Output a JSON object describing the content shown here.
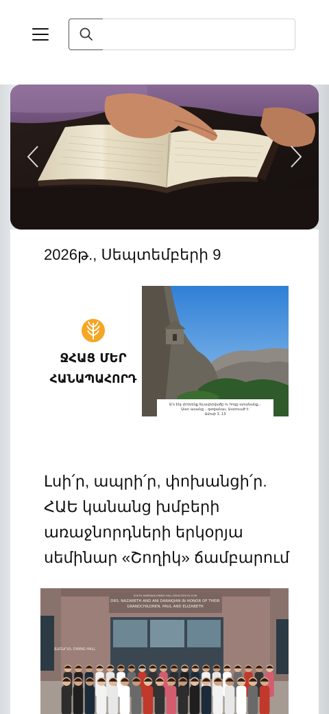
{
  "header": {
    "menu_icon": "hamburger-menu-icon",
    "search_icon": "search-icon",
    "search_placeholder": "",
    "search_value": ""
  },
  "carousel": {
    "prev_icon": "chevron-left-icon",
    "next_icon": "chevron-right-icon"
  },
  "post1": {
    "date": "2026թ., Սեպտեմբերի 9",
    "banner_logo_text_line1": "ՋՀԱՑ ՄԵՐ",
    "banner_logo_text_line2": "ՀԱՆԱՊԱՀՈՐԴ",
    "banner_caption_line1": "Ա՛ռ ինչ փոխենք ձևավորվածը ու հոգը ստանանք...",
    "banner_caption_line2": "Աստ ասանց... գտցանաւ. Աստուած է:",
    "banner_caption_ref": "Ամոսի 3. 13"
  },
  "post2": {
    "title": "Լսի՛ր, ապրի՛ր, փոխանցի՛ր. ՀԱԵ կանանց խմբերի առաջնորդների երկօրյա սեմինար «Շողիկ» ճամբարում",
    "sign_line1": "SOUTH ARMENIAN DINING HALL DEDICATED IN 2006",
    "sign_line2": "DRS. NAZARETH AND ANI DARAKJIAN IN HONOR OF THEIR",
    "sign_line3": "GRANDCHILDREN, PAUL AND ELIZABETH",
    "sign_side": "ՃԱՇԱՐԱՆ DINING HALL"
  },
  "colors": {
    "logo_orange": "#f5a623",
    "caption_bg": "#ffffff",
    "card_bg": "#ffffff"
  }
}
